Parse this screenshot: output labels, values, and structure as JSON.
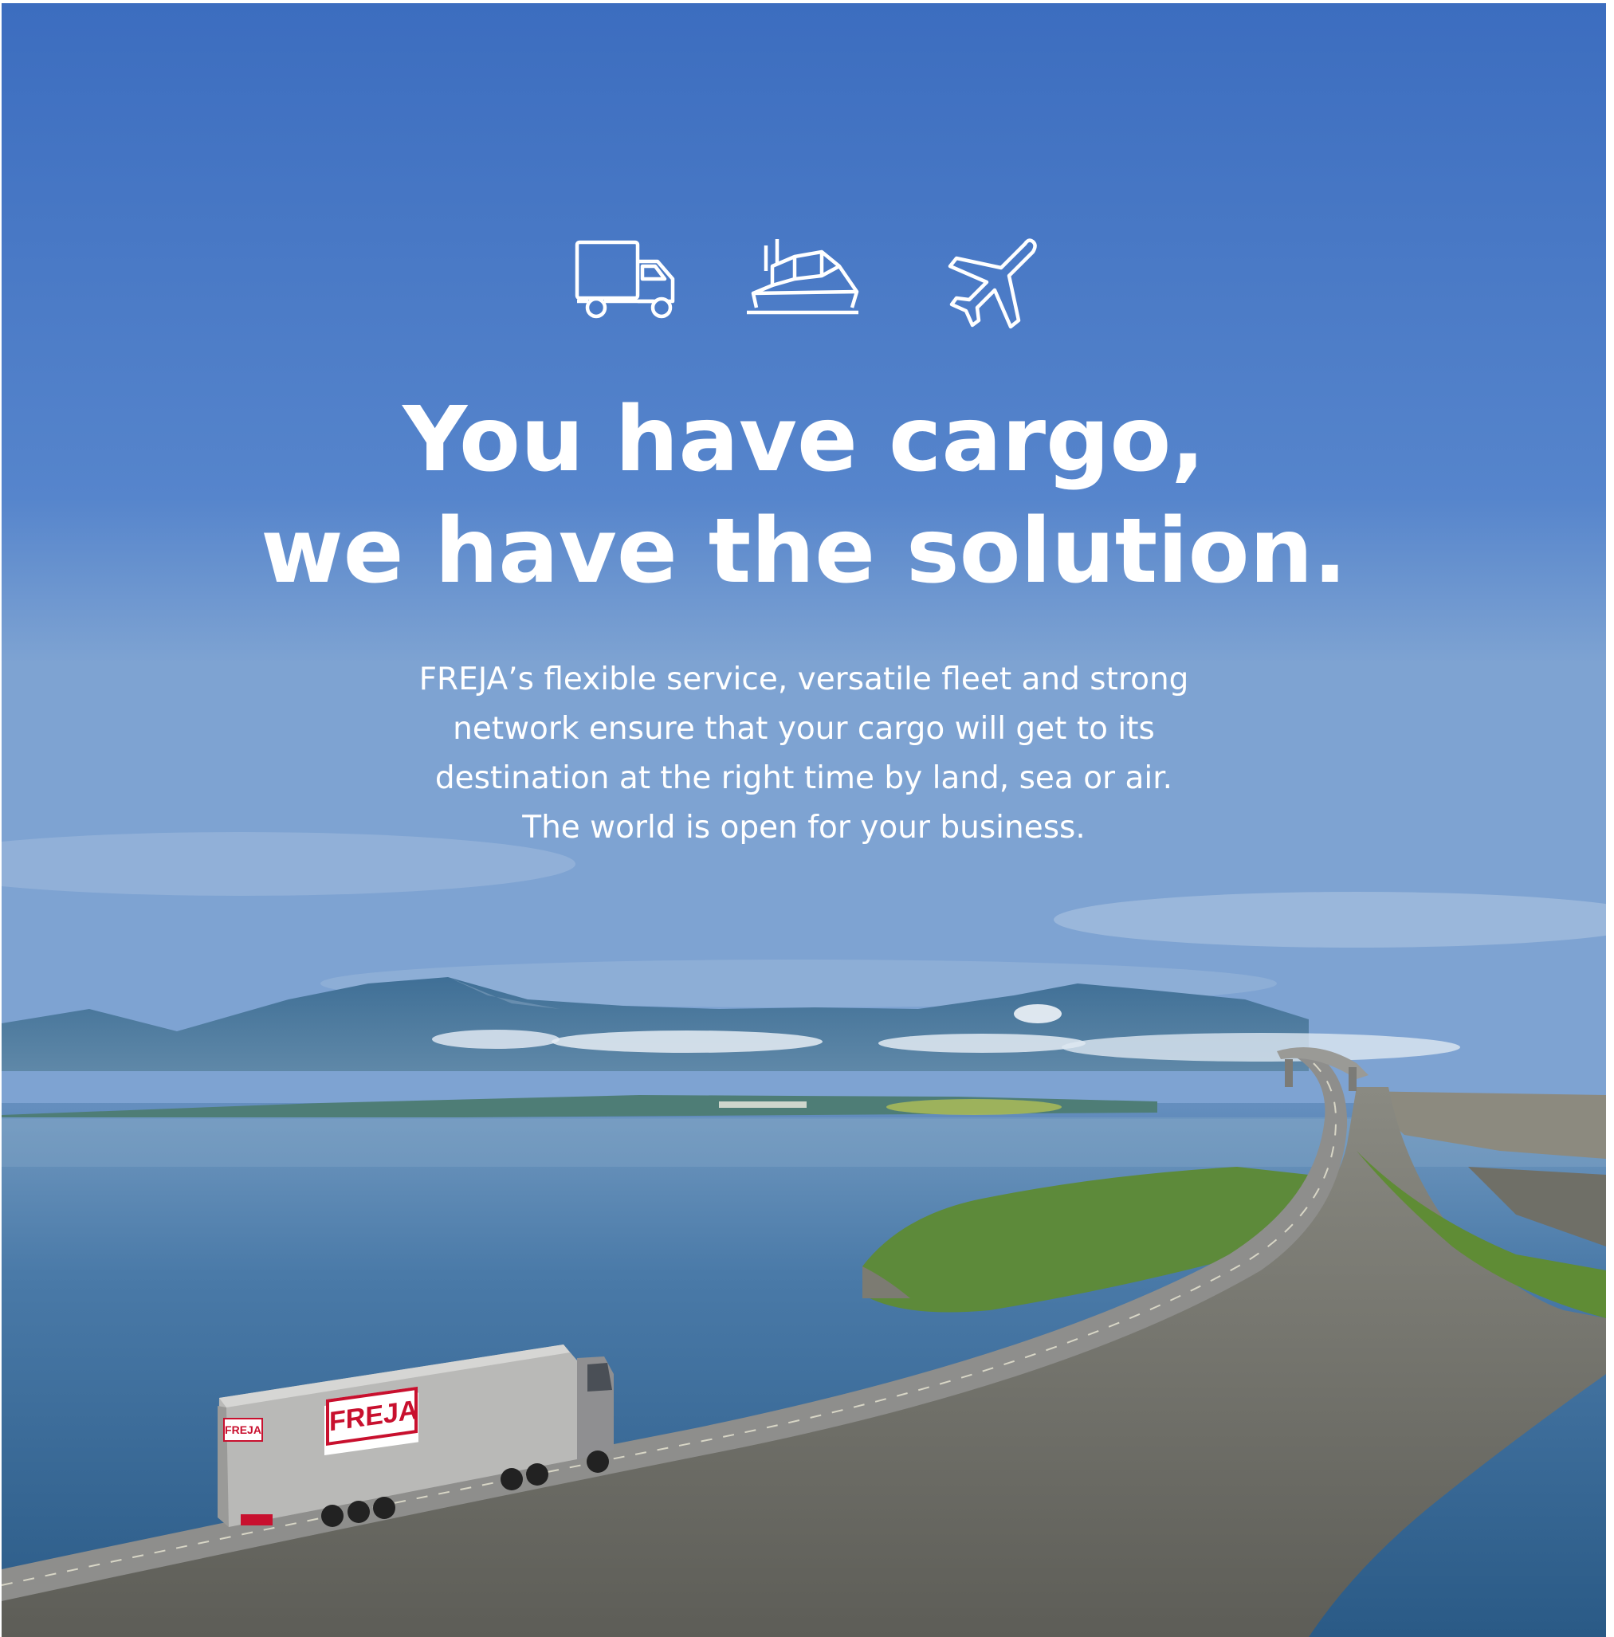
{
  "headline": {
    "line1": "You have cargo,",
    "line2": "we have the solution."
  },
  "body": {
    "line1": "FREJA’s flexible service, versatile fleet and strong",
    "line2": "network ensure that your cargo will get to its",
    "line3": "destination at the right time by land, sea or air.",
    "line4": "The world is open for your business."
  },
  "icons": [
    "truck-icon",
    "ship-icon",
    "airplane-icon"
  ],
  "truck_branding": {
    "side_logo": "FREJA",
    "rear_logo": "FREJA"
  },
  "colors": {
    "sky": "#4a7bc8",
    "water": "#2f5f8a",
    "text": "#ffffff",
    "brand_red": "#c8102e"
  }
}
